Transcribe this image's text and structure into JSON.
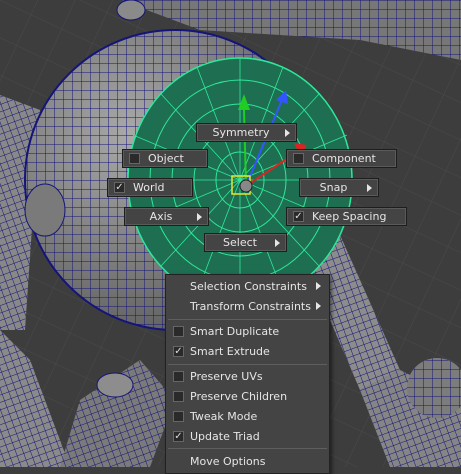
{
  "marking_menu": {
    "symmetry": "Symmetry",
    "object": "Object",
    "component": "Component",
    "world": "World",
    "snap": "Snap",
    "axis": "Axis",
    "keep_spacing": "Keep Spacing",
    "select": "Select"
  },
  "dropdown": {
    "selection_constraints": "Selection Constraints",
    "transform_constraints": "Transform Constraints",
    "smart_duplicate": "Smart Duplicate",
    "smart_extrude": "Smart Extrude",
    "preserve_uvs": "Preserve UVs",
    "preserve_children": "Preserve Children",
    "tweak_mode": "Tweak Mode",
    "update_triad": "Update Triad",
    "move_options": "Move Options"
  },
  "checks": {
    "object": false,
    "component": false,
    "world": true,
    "keep_spacing": true,
    "smart_duplicate": false,
    "smart_extrude": true,
    "preserve_uvs": false,
    "preserve_children": false,
    "tweak_mode": false,
    "update_triad": true
  },
  "check_glyph": "✓",
  "colors": {
    "viewport_bg": "#3d3d3d",
    "wire": "#14147a",
    "selection": "#2ee89a"
  },
  "icons": [
    "submenu-arrow-icon",
    "checkbox-icon",
    "move-manipulator-icon"
  ]
}
